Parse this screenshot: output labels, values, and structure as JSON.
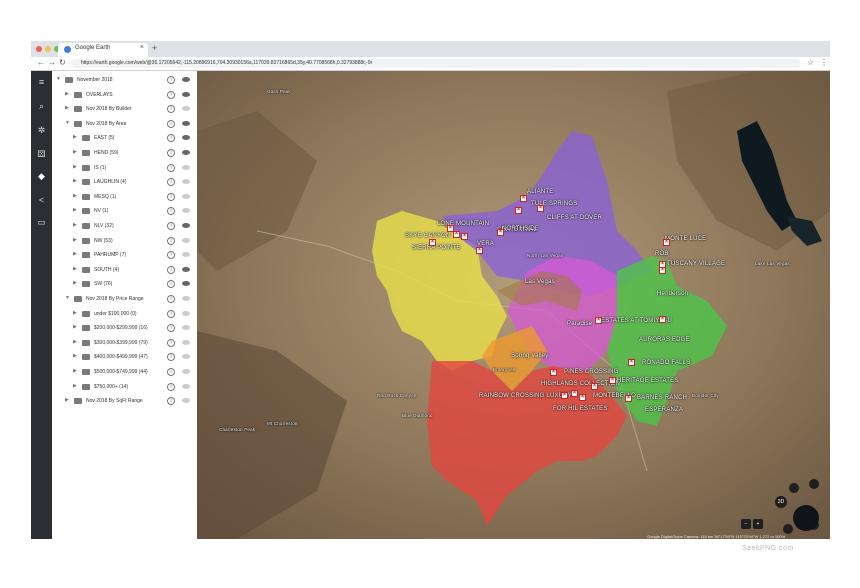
{
  "browser": {
    "tab_title": "Google Earth",
    "tab_close": "×",
    "new_tab": "+",
    "url": "https://earth.google.com/web/@36.17205642,-115.20896916,704.30930156a,117039.83716865d,35y,40.7708568h,0.32793888t,-0r",
    "back": "←",
    "forward": "→",
    "reload": "↻",
    "star": "☆",
    "menu": "⋮",
    "colors": {
      "close": "#ee5f57",
      "min": "#f6be4f",
      "max": "#62c554"
    }
  },
  "rail": {
    "icons": [
      "menu-icon",
      "search-icon",
      "voyager-icon",
      "feeling-lucky-icon",
      "projects-icon",
      "share-icon",
      "measure-icon"
    ],
    "glyphs": [
      "≡",
      "⌕",
      "✲",
      "⚄",
      "◆",
      "<",
      "▭"
    ]
  },
  "panel": {
    "rows": [
      {
        "label": "November 2018",
        "indent": 0,
        "arrow": "▼",
        "visible": true
      },
      {
        "label": "OVERLAYS",
        "indent": 1,
        "arrow": "▶",
        "visible": true
      },
      {
        "label": "Nov 2018 By Builder",
        "indent": 1,
        "arrow": "▶",
        "visible": false
      },
      {
        "label": "Nov 2018 By Area",
        "indent": 1,
        "arrow": "▼",
        "visible": true
      },
      {
        "label": "EAST (5)",
        "indent": 2,
        "arrow": "▶",
        "visible": true
      },
      {
        "label": "HEND (59)",
        "indent": 2,
        "arrow": "▶",
        "visible": true
      },
      {
        "label": "IS (1)",
        "indent": 2,
        "arrow": "▶",
        "visible": false
      },
      {
        "label": "LAUGHLIN (4)",
        "indent": 2,
        "arrow": "▶",
        "visible": false
      },
      {
        "label": "MESQ (1)",
        "indent": 2,
        "arrow": "▶",
        "visible": false
      },
      {
        "label": "NV (1)",
        "indent": 2,
        "arrow": "▶",
        "visible": false
      },
      {
        "label": "NLV (32)",
        "indent": 2,
        "arrow": "▶",
        "visible": true
      },
      {
        "label": "NW (53)",
        "indent": 2,
        "arrow": "▶",
        "visible": false
      },
      {
        "label": "PAHRUMP (7)",
        "indent": 2,
        "arrow": "▶",
        "visible": false
      },
      {
        "label": "SOUTH (4)",
        "indent": 2,
        "arrow": "▶",
        "visible": true
      },
      {
        "label": "SW (76)",
        "indent": 2,
        "arrow": "▶",
        "visible": true
      },
      {
        "label": "Nov 2018 By Price Range",
        "indent": 1,
        "arrow": "▼",
        "visible": false
      },
      {
        "label": "under $100,000 (0)",
        "indent": 2,
        "arrow": "▶",
        "visible": false
      },
      {
        "label": "$200,000-$299,999 (16)",
        "indent": 2,
        "arrow": "▶",
        "visible": false
      },
      {
        "label": "$300,000-$399,999 (79)",
        "indent": 2,
        "arrow": "▶",
        "visible": false
      },
      {
        "label": "$400,000-$499,999 (47)",
        "indent": 2,
        "arrow": "▶",
        "visible": false
      },
      {
        "label": "$500,000-$749,999 (44)",
        "indent": 2,
        "arrow": "▶",
        "visible": false
      },
      {
        "label": "$750,000+ (14)",
        "indent": 2,
        "arrow": "▶",
        "visible": false
      },
      {
        "label": "Nov 2018 By SqFt Range",
        "indent": 1,
        "arrow": "▶",
        "visible": false
      }
    ],
    "info_glyph": "i"
  },
  "map": {
    "colors": {
      "purple": "#8a62d6",
      "pink": "#d65ad6",
      "green": "#4ec44a",
      "red": "#e2463f",
      "yellow": "#e8e04a",
      "orange": "#ee9a30",
      "terrain": "#9b8468"
    },
    "labels": [
      {
        "id": "spring-peak",
        "text": "Gass Peak",
        "sm": true
      },
      {
        "id": "aliante",
        "text": "ALIANTE"
      },
      {
        "id": "tule",
        "text": "TULE SPRINGS"
      },
      {
        "id": "cliffs",
        "text": "CLIFFS AT DOVER"
      },
      {
        "id": "lone-mountain",
        "text": "LONE MOUNTAIN"
      },
      {
        "id": "centennial",
        "text": "CENTENNIAL"
      },
      {
        "id": "summerlin",
        "text": "SKYE CANYON"
      },
      {
        "id": "sierra",
        "text": "SIERRA POINTE"
      },
      {
        "id": "vera",
        "text": "VERA"
      },
      {
        "id": "northside",
        "text": "NORTHSIDE"
      },
      {
        "id": "las-vegas",
        "text": "Las Vegas"
      },
      {
        "id": "north-las-vegas",
        "text": "North Las Vegas",
        "sm": true
      },
      {
        "id": "monte",
        "text": "MONTE LUCE"
      },
      {
        "id": "rob",
        "text": "ROB"
      },
      {
        "id": "tuscany",
        "text": "TUSCANY VILLAGE"
      },
      {
        "id": "henderson",
        "text": "Henderson"
      },
      {
        "id": "paradise",
        "text": "Paradise"
      },
      {
        "id": "estates",
        "text": "ESTATES AT TOMIYASU"
      },
      {
        "id": "auroras",
        "text": "AURORAS EDGE"
      },
      {
        "id": "spring-valley",
        "text": "Spring Valley"
      },
      {
        "id": "pines",
        "text": "PINES CROSSING"
      },
      {
        "id": "highlands",
        "text": "HIGHLANDS COLLECTION"
      },
      {
        "id": "rainbow",
        "text": "RAINBOW CROSSING LUXURY"
      },
      {
        "id": "forhill",
        "text": "FOR HIL ESTATES"
      },
      {
        "id": "montebello",
        "text": "MONTEBELLO"
      },
      {
        "id": "ronado",
        "text": "RONADO FALLS"
      },
      {
        "id": "heritage",
        "text": "HERITAGE ESTATES"
      },
      {
        "id": "barnes",
        "text": "BARNES RANCH"
      },
      {
        "id": "esperanza",
        "text": "ESPERANZA"
      },
      {
        "id": "enterprise",
        "text": "Enterprise",
        "sm": true
      },
      {
        "id": "charleston",
        "text": "Charleston Peak",
        "sm": true
      },
      {
        "id": "mt-charleston",
        "text": "Mt Charleston",
        "sm": true
      },
      {
        "id": "blue-diamond",
        "text": "Blue Diamond",
        "sm": true
      },
      {
        "id": "red-rock",
        "text": "Red Rock Canyon",
        "sm": true
      },
      {
        "id": "lake-las-vegas",
        "text": "Lake Las Vegas",
        "sm": true
      },
      {
        "id": "boulder",
        "text": "Boulder City",
        "sm": true
      }
    ],
    "pin_glyph": "×",
    "controls": {
      "three_d": "3D",
      "zoom_in": "+",
      "zoom_out": "−"
    },
    "attribution": "Google  DigitalGlobe   Camera: 118 km  36°17'50\"N 115°23'44\"W  1,272 m  100%"
  },
  "watermark": "SeekPNG.com"
}
